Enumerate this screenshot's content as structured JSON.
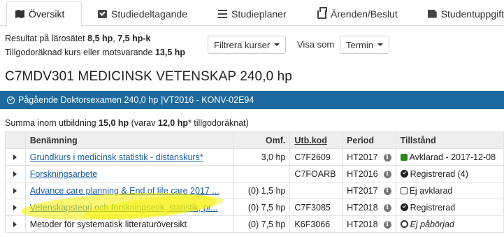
{
  "tabs": [
    {
      "label": "Översikt",
      "icon": "map-icon",
      "active": true
    },
    {
      "label": "Studiedeltagande",
      "icon": "check-square-icon"
    },
    {
      "label": "Studieplaner",
      "icon": "list-icon"
    },
    {
      "label": "Ärenden/Beslut",
      "icon": "inbox-icon"
    },
    {
      "label": "Studentuppgift",
      "icon": "file-icon"
    }
  ],
  "summary": {
    "line1_prefix": "Resultat på lärosätet",
    "line1_hp": "8,5 hp",
    "line1_sep": ",",
    "line1_hpk": "7,5 hp-k",
    "line2_prefix": "Tillgodoräknad kurs eller motsvarande",
    "line2_hp": "13,5 hp"
  },
  "filter_button": "Filtrera kurser",
  "visa_som_label": "Visa som",
  "visa_som_select": "Termin",
  "program": {
    "title": "C7MDV301 MEDICINSK VETENSKAP 240,0 hp",
    "bar_text": "Pågående Doktorsexamen 240,0 hp",
    "bar_detail": "|VT2016 - KONV-02E94"
  },
  "summa": {
    "prefix": "Summa inom utbildning",
    "total": "15,0 hp",
    "mid": "(varav",
    "credited": "12,0 hp",
    "suffix": "* tillgodoräknat)"
  },
  "table": {
    "headers": [
      "Benämning",
      "Omf.",
      "Utb.kod",
      "Period",
      "Tillstånd"
    ],
    "rows": [
      {
        "name": "Grundkurs i medicinsk statistik - distanskurs*",
        "link": true,
        "omf": "3,0 hp",
        "kod": "C7F2609",
        "period": "HT2017",
        "status": "Avklarad - 2017-12-08",
        "status_type": "done"
      },
      {
        "name": "Forskningsarbete",
        "link": true,
        "omf": "",
        "kod": "C7FOARB",
        "period": "HT2016",
        "status": "Registrerad (4)",
        "status_type": "registered"
      },
      {
        "name": "Advance care planning & End of life care 2017 ...",
        "link": true,
        "omf": "(0) 1,5 hp",
        "kod": "",
        "period": "HT2017",
        "status": "Ej avklarad",
        "status_type": "not-done"
      },
      {
        "name": "Vetenskapsteori och forskningsetik, statistik, pr...",
        "link": true,
        "omf": "(0) 7,5 hp",
        "kod": "C7F3085",
        "period": "HT2018",
        "status": "Registrerad",
        "status_type": "registered"
      },
      {
        "name": "Metoder för systematisk litteraturöversikt",
        "link": false,
        "omf": "(0) 7,5 hp",
        "kod": "K6F3066",
        "period": "HT2018",
        "status": "Ej påbörjad",
        "status_type": "not-started"
      }
    ]
  },
  "colors": {
    "program_bar": "#1d6aa0",
    "link": "#1a5fa6",
    "done_green": "#2b8a1a",
    "highlight": "#f5f200"
  }
}
